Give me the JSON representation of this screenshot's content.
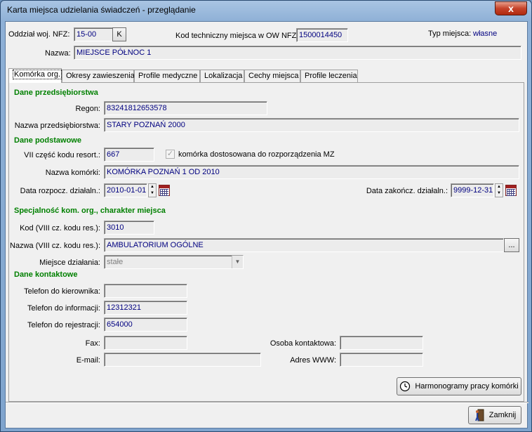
{
  "window": {
    "title": "Karta miejsca udzielania świadczeń - przeglądanie",
    "close_label": "x"
  },
  "header": {
    "oddzial_label": "Oddział woj. NFZ:",
    "oddzial_value": "15-00",
    "oddzial_btn": "K",
    "kod_tech_label": "Kod techniczny miejsca w OW NFZ:",
    "kod_tech_value": "1500014450",
    "typ_label": "Typ miejsca:",
    "typ_value": "własne",
    "nazwa_label": "Nazwa:",
    "nazwa_value": "MIEJSCE PÓŁNOC 1"
  },
  "tabs": [
    {
      "label": "Komórka org."
    },
    {
      "label": "Okresy zawieszenia"
    },
    {
      "label": "Profile medyczne"
    },
    {
      "label": "Lokalizacja"
    },
    {
      "label": "Cechy miejsca"
    },
    {
      "label": "Profile leczenia"
    }
  ],
  "przedsiebiorstwo": {
    "section": "Dane przedsiębiorstwa",
    "regon_label": "Regon:",
    "regon_value": "83241812653578",
    "nazwa_label": "Nazwa przedsiębiorstwa:",
    "nazwa_value": "STARY POZNAŃ 2000"
  },
  "podstawowe": {
    "section": "Dane podstawowe",
    "vii_label": "VII część kodu resort.:",
    "vii_value": "667",
    "mz_label": "komórka dostosowana do rozporządzenia MZ",
    "nazwa_kom_label": "Nazwa komórki:",
    "nazwa_kom_value": "KOMÓRKA POZNAŃ 1 OD 2010",
    "data_rozp_label": "Data rozpocz. działaln.:",
    "data_rozp_value": "2010-01-01",
    "data_zak_label": "Data zakończ. działaln.:",
    "data_zak_value": "9999-12-31"
  },
  "specjalnosc": {
    "section": "Specjalność kom. org., charakter miejsca",
    "kod_label": "Kod (VIII cz. kodu res.):",
    "kod_value": "3010",
    "nazwa_label": "Nazwa (VIII cz. kodu res.):",
    "nazwa_value": "AMBULATORIUM OGÓLNE",
    "ellipsis": "...",
    "miejsce_label": "Miejsce działania:",
    "miejsce_value": "stałe"
  },
  "kontakt": {
    "section": "Dane kontaktowe",
    "tel_kier_label": "Telefon do kierownika:",
    "tel_kier_value": "",
    "tel_info_label": "Telefon do informacji:",
    "tel_info_value": "12312321",
    "tel_rej_label": "Telefon do rejestracji:",
    "tel_rej_value": "654000",
    "fax_label": "Fax:",
    "fax_value": "",
    "osoba_label": "Osoba kontaktowa:",
    "osoba_value": "",
    "email_label": "E-mail:",
    "email_value": "",
    "www_label": "Adres WWW:",
    "www_value": ""
  },
  "buttons": {
    "harmonogramy": "Harmonogramy pracy komórki",
    "zamknij": "Zamknij"
  }
}
